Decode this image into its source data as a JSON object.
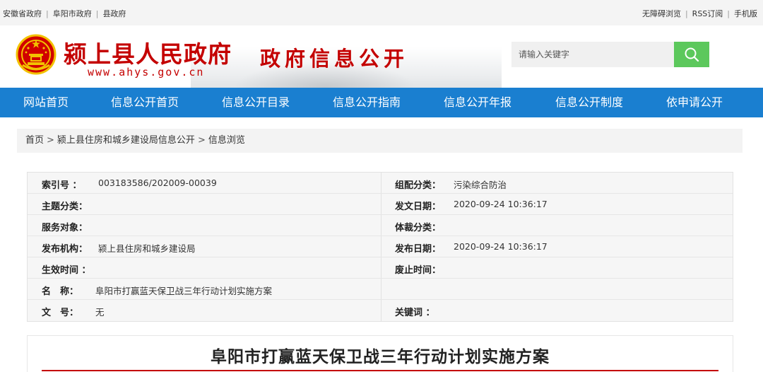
{
  "topbar": {
    "links_left": [
      "安徽省政府",
      "阜阳市政府",
      "县政府"
    ],
    "links_right": [
      "无障碍浏览",
      "RSS订阅",
      "手机版"
    ]
  },
  "header": {
    "site_title": "颍上县人民政府",
    "site_url": "www.ahys.gov.cn",
    "section_title": "政府信息公开",
    "search_placeholder": "请输入关键字",
    "emblem_icon": "national-emblem-icon",
    "search_icon": "search-icon"
  },
  "nav": {
    "items": [
      "网站首页",
      "信息公开首页",
      "信息公开目录",
      "信息公开指南",
      "信息公开年报",
      "信息公开制度",
      "依申请公开"
    ]
  },
  "breadcrumb": {
    "items": [
      "首页",
      "颍上县住房和城乡建设局信息公开",
      "信息浏览"
    ],
    "separator": ">"
  },
  "info": {
    "index_label": "索引号 ：",
    "index_value": "003183586/202009-00039",
    "category_label": "组配分类：",
    "category_value": "污染综合防治",
    "topic_label": "主题分类：",
    "topic_value": "",
    "issue_date_label": "发文日期：",
    "issue_date_value": "2020-09-24 10:36:17",
    "audience_label": "服务对象：",
    "audience_value": "",
    "genre_label": "体裁分类：",
    "genre_value": "",
    "publisher_label": "发布机构：",
    "publisher_value": "颍上县住房和城乡建设局",
    "publish_date_label": "发布日期：",
    "publish_date_value": "2020-09-24 10:36:17",
    "effective_label": "生效时间 ：",
    "effective_value": "",
    "expiry_label": "废止时间：",
    "expiry_value": "",
    "name_label": "名　称：",
    "name_value": "阜阳市打赢蓝天保卫战三年行动计划实施方案",
    "docno_label": "文　号：",
    "docno_value": "无",
    "keywords_label": "关键词 ：",
    "keywords_value": ""
  },
  "article": {
    "title": "阜阳市打赢蓝天保卫战三年行动计划实施方案"
  },
  "colors": {
    "brand_red": "#c40000",
    "nav_blue": "#1a7fd0",
    "search_green": "#5cc85c"
  }
}
